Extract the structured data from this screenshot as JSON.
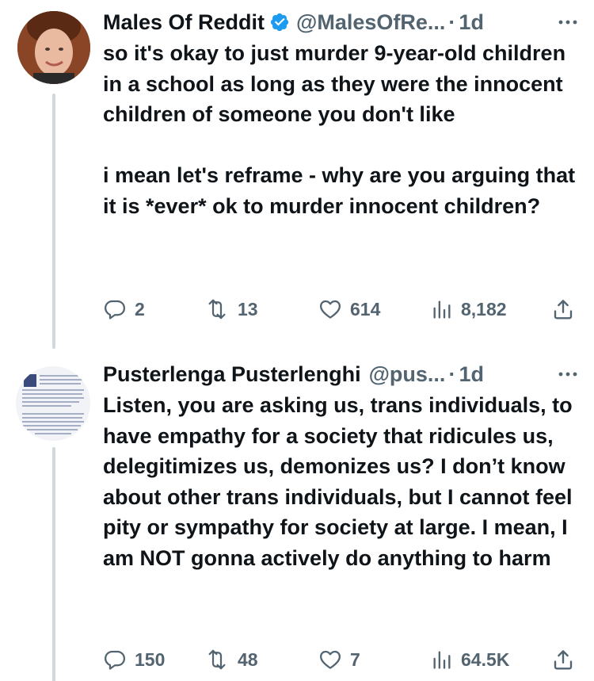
{
  "tweets": [
    {
      "display_name": "Males Of Reddit",
      "verified": true,
      "handle": "@MalesOfRe...",
      "separator": "·",
      "time": "1d",
      "body": "so it's okay to just murder 9-year-old children in a school as long as they were the innocent children of someone you don't like\n\ni mean let's reframe - why are you arguing that it is *ever* ok to murder innocent children?",
      "stats": {
        "replies": "2",
        "retweets": "13",
        "likes": "614",
        "views": "8,182"
      }
    },
    {
      "display_name": "Pusterlenga Pusterlenghi",
      "verified": false,
      "handle": "@pus...",
      "separator": "·",
      "time": "1d",
      "body": "Listen, you are asking us, trans individuals, to have empathy for a society that ridicules us, delegitimizes us, demonizes us? I don’t know about other trans individuals, but I cannot feel pity or sympathy for society at large. I mean, I am NOT gonna actively do anything to harm",
      "stats": {
        "replies": "150",
        "retweets": "48",
        "likes": "7",
        "views": "64.5K"
      }
    }
  ],
  "icons": {
    "verified": "verified-badge-icon",
    "more": "more-icon",
    "reply": "reply-icon",
    "retweet": "retweet-icon",
    "like": "heart-icon",
    "views": "views-icon",
    "share": "share-icon"
  },
  "colors": {
    "text": "#0f1419",
    "secondary": "#536471",
    "verified": "#1d9bf0",
    "thread_line": "#cfd9de"
  }
}
